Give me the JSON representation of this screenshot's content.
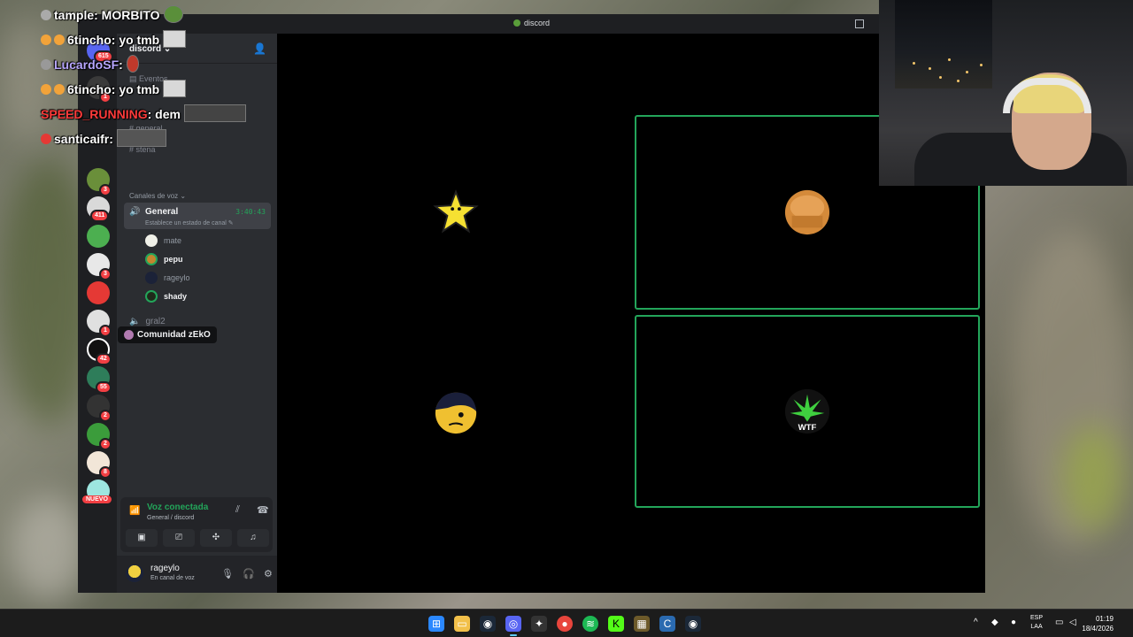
{
  "window": {
    "title": "discord"
  },
  "server_rail": {
    "badges": [
      "615",
      "1",
      "3",
      "411",
      "3",
      "1",
      "42",
      "55",
      "2",
      "2",
      "8"
    ],
    "new_label": "NUEVO"
  },
  "channel_sidebar": {
    "server_name": "discord ⌄",
    "events_label": "Eventos",
    "text_channels": [
      "general",
      "stena"
    ],
    "voice_category": "Canales de voz ⌄",
    "voice_channel_active": {
      "name": "General",
      "timer": "3:40:43",
      "status": "Establece un estado de canal ✎",
      "members": [
        {
          "name": "mate",
          "muted_style": true
        },
        {
          "name": "pepu",
          "muted_style": false
        },
        {
          "name": "rageylo",
          "muted_style": true
        },
        {
          "name": "shady",
          "muted_style": false
        }
      ]
    },
    "voice_channel_2": "gral2",
    "tooltip": "Comunidad zEkO"
  },
  "voice_panel": {
    "status": "Voz conectada",
    "location": "General / discord"
  },
  "user_panel": {
    "username": "rageylo",
    "status": "En canal de voz"
  },
  "stage": {
    "tiles": [
      {
        "user": "mate",
        "bg": "#f2f5ee",
        "avatar": "star"
      },
      {
        "user": "pepu",
        "bg": "#b87a3a",
        "avatar": "muffin"
      },
      {
        "user": "rageylo",
        "bg": "#1b1c3a",
        "avatar": "emo-face"
      },
      {
        "user": "shady",
        "bg": "#5bea44",
        "avatar": "wtf-leaf",
        "avatar_text": "WTF"
      }
    ]
  },
  "chat": {
    "messages": [
      {
        "nick": "tample",
        "text": ": MORBITO",
        "nick_color": "#ffffff"
      },
      {
        "nick": "6tincho",
        "text": ": yo tmb",
        "nick_color": "#ffffff"
      },
      {
        "nick": "LucardoSF",
        "text": ":",
        "nick_color": "#b7a6ff"
      },
      {
        "nick": "6tincho",
        "text": ": yo tmb",
        "nick_color": "#ffffff"
      },
      {
        "nick": "SPEED_RUNNING",
        "text": ": dem",
        "nick_color": "#ff3b3b"
      },
      {
        "nick": "santicaifr",
        "text": ":",
        "nick_color": "#ffffff"
      }
    ]
  },
  "taskbar": {
    "lang_top": "ESP",
    "lang_bottom": "LAA",
    "time": "01:19",
    "date": "18/4/2026"
  },
  "colors": {
    "accent_green": "#23a55a",
    "badge_red": "#f23f43"
  }
}
